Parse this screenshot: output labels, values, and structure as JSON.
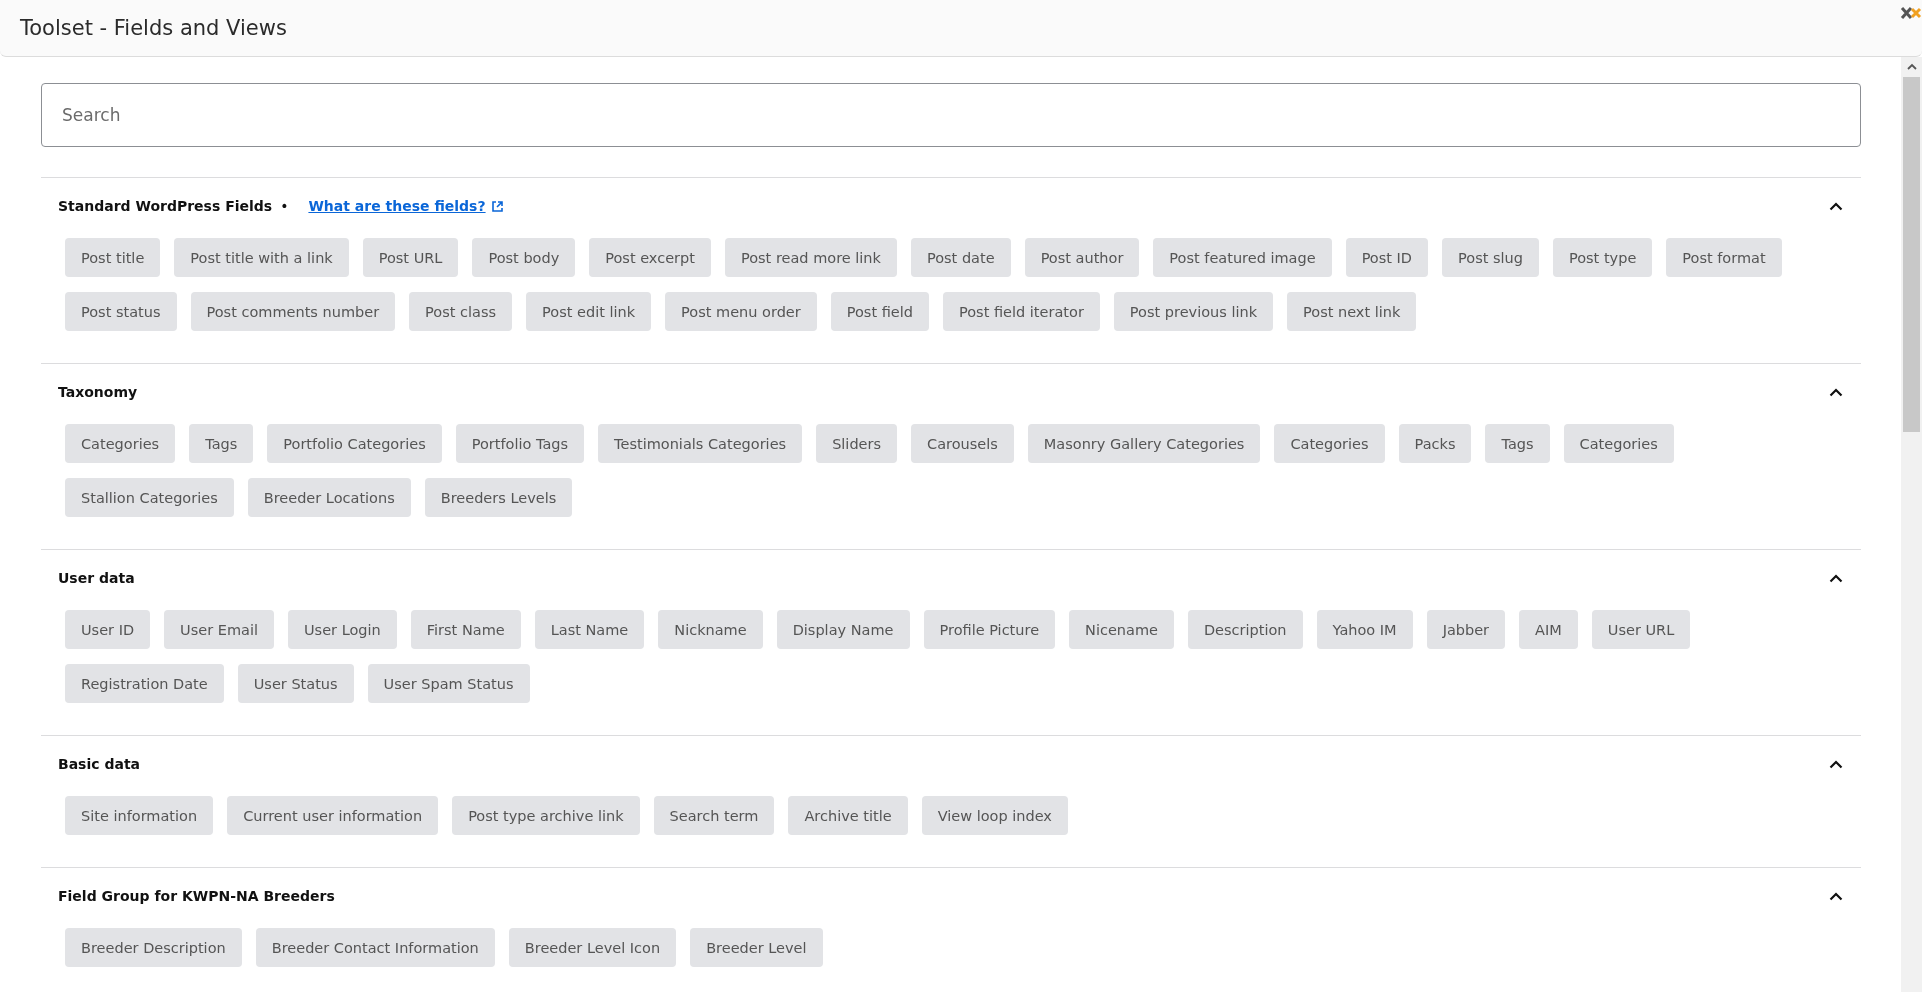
{
  "window": {
    "title": "Toolset - Fields and Views"
  },
  "search": {
    "placeholder": "Search"
  },
  "sections": [
    {
      "title": "Standard WordPress Fields",
      "separator": "•",
      "link": "What are these fields?",
      "expanded": true,
      "fields": [
        "Post title",
        "Post title with a link",
        "Post URL",
        "Post body",
        "Post excerpt",
        "Post read more link",
        "Post date",
        "Post author",
        "Post featured image",
        "Post ID",
        "Post slug",
        "Post type",
        "Post format",
        "Post status",
        "Post comments number",
        "Post class",
        "Post edit link",
        "Post menu order",
        "Post field",
        "Post field iterator",
        "Post previous link",
        "Post next link"
      ]
    },
    {
      "title": "Taxonomy",
      "expanded": true,
      "fields": [
        "Categories",
        "Tags",
        "Portfolio Categories",
        "Portfolio Tags",
        "Testimonials Categories",
        "Sliders",
        "Carousels",
        "Masonry Gallery Categories",
        "Categories",
        "Packs",
        "Tags",
        "Categories",
        "Stallion Categories",
        "Breeder Locations",
        "Breeders Levels"
      ]
    },
    {
      "title": "User data",
      "expanded": true,
      "fields": [
        "User ID",
        "User Email",
        "User Login",
        "First Name",
        "Last Name",
        "Nickname",
        "Display Name",
        "Profile Picture",
        "Nicename",
        "Description",
        "Yahoo IM",
        "Jabber",
        "AIM",
        "User URL",
        "Registration Date",
        "User Status",
        "User Spam Status"
      ]
    },
    {
      "title": "Basic data",
      "expanded": true,
      "fields": [
        "Site information",
        "Current user information",
        "Post type archive link",
        "Search term",
        "Archive title",
        "View loop index"
      ]
    },
    {
      "title": "Field Group for KWPN-NA Breeders",
      "expanded": true,
      "fields": [
        "Breeder Description",
        "Breeder Contact Information",
        "Breeder Level Icon",
        "Breeder Level"
      ]
    }
  ]
}
